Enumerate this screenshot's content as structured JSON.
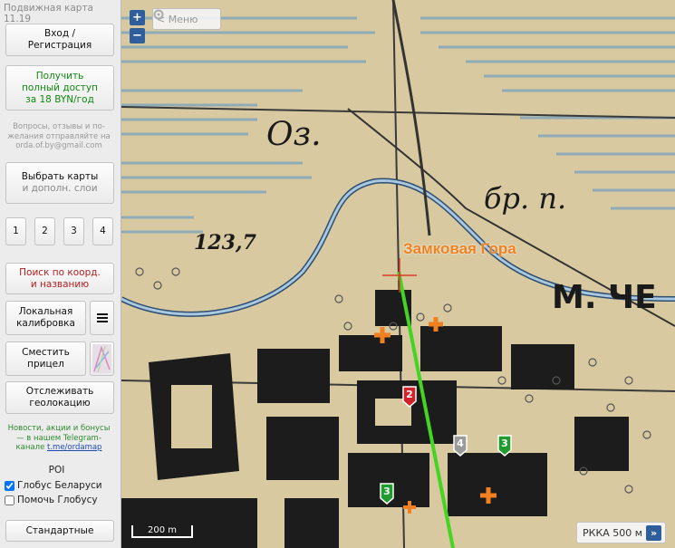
{
  "app": {
    "title": "Подвижная карта 11.19"
  },
  "sidebar": {
    "login": "Вход /\nРегистрация",
    "full_access": "Получить\nполный доступ\nза 18 BYN/год",
    "contact": "Вопросы, отзывы и по-желания отправляйте на orda.of.by@gmail.com",
    "choose_maps": "Выбрать карты",
    "choose_maps_sub": "и дополн. слои",
    "page_numbers": [
      "1",
      "2",
      "3",
      "4"
    ],
    "search": "Поиск по коорд.\nи названию",
    "calibration": "Локальная\nкалибровка",
    "shift_sight": "Сместить\nприцел",
    "track_geo": "Отслеживать\nгеолокацию",
    "news_text": "Новости, акции и бонусы — в нашем Telegram-канале",
    "news_link": "t.me/ordamap",
    "poi_title": "POI",
    "poi_globe": "Глобус Беларуси",
    "poi_help": "Помочь Глобусу",
    "standard": "Стандартные"
  },
  "map": {
    "zoom_in": "+",
    "zoom_out": "−",
    "menu_label": "< Меню",
    "place_label": "Замковая Гора",
    "scale_label": "200 m",
    "layer_name": "РККА 500 м",
    "layer_arrow": "»",
    "markers": [
      {
        "num": "2",
        "color": "#d2232a"
      },
      {
        "num": "4",
        "color": "#9a9a9a"
      },
      {
        "num": "3",
        "color": "#1e9c2e"
      },
      {
        "num": "3",
        "color": "#1e9c2e"
      }
    ],
    "map_texts": [
      "123,7",
      "Оз.",
      "бр. п.",
      "М. ЧЕ"
    ],
    "colors": {
      "accent": "#2e5f9c",
      "route": "#44d422",
      "poi_orange": "#f08020"
    }
  }
}
